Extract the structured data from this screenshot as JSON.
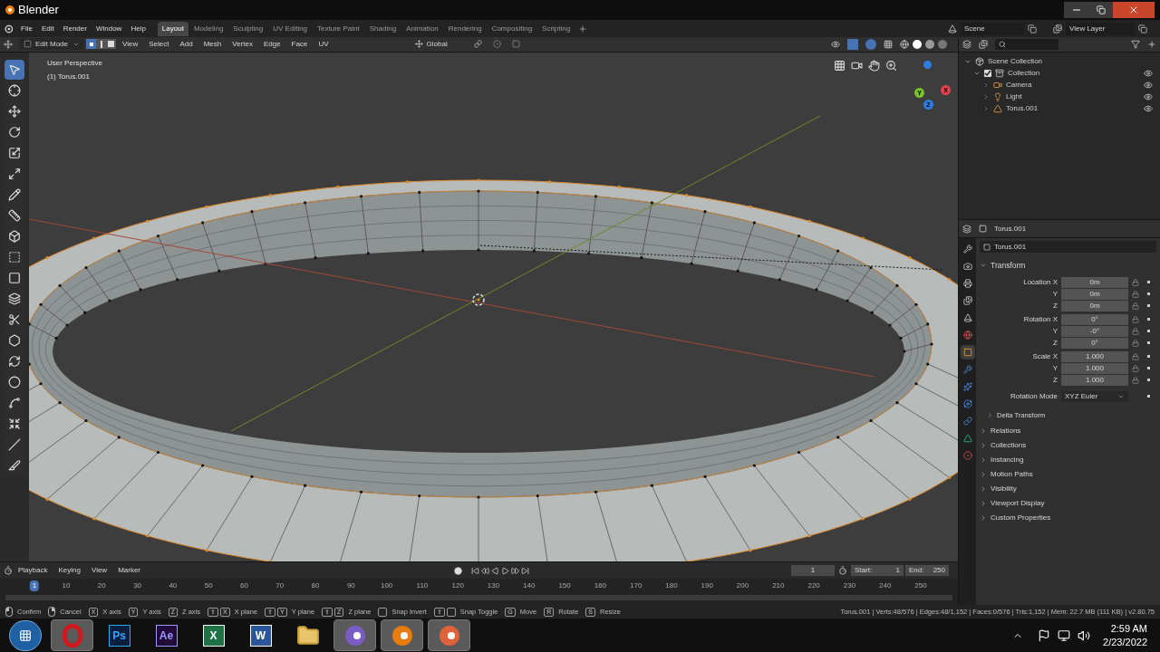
{
  "window": {
    "title": "Blender"
  },
  "menu": [
    "File",
    "Edit",
    "Render",
    "Window",
    "Help"
  ],
  "workspaces": [
    {
      "label": "Layout",
      "selected": true
    },
    {
      "label": "Modeling",
      "selected": false
    },
    {
      "label": "Sculpting",
      "selected": false
    },
    {
      "label": "UV Editing",
      "selected": false
    },
    {
      "label": "Texture Paint",
      "selected": false
    },
    {
      "label": "Shading",
      "selected": false
    },
    {
      "label": "Animation",
      "selected": false
    },
    {
      "label": "Rendering",
      "selected": false
    },
    {
      "label": "Compositing",
      "selected": false
    },
    {
      "label": "Scripting",
      "selected": false
    }
  ],
  "scene": {
    "scene": "Scene",
    "view_layer": "View Layer"
  },
  "viewport_header": {
    "mode": "Edit Mode",
    "select_modes": [
      {
        "kind": "vertex",
        "selected": true
      },
      {
        "kind": "edge",
        "selected": false
      },
      {
        "kind": "face",
        "selected": false
      }
    ],
    "menus": [
      "View",
      "Select",
      "Add",
      "Mesh",
      "Vertex",
      "Edge",
      "Face",
      "UV"
    ],
    "orientation": "Global"
  },
  "viewport": {
    "view_name": "User Perspective",
    "object_label": "(1) Torus.001",
    "gizmo": [
      {
        "label": "X",
        "color": "#e5414d"
      },
      {
        "label": "Y",
        "color": "#7bbf2a"
      },
      {
        "label": "Z",
        "color": "#2f7de0"
      }
    ]
  },
  "tools": [
    {
      "kind": "select",
      "selected": true
    },
    {
      "kind": "cursor",
      "selected": false
    },
    {
      "kind": "move",
      "selected": false
    },
    {
      "kind": "rotate",
      "selected": false
    },
    {
      "kind": "scale",
      "selected": false
    },
    {
      "kind": "transform",
      "selected": false
    },
    {
      "kind": "annotate",
      "selected": false
    },
    {
      "kind": "measure",
      "selected": false
    },
    {
      "kind": "extrude",
      "selected": false
    },
    {
      "kind": "inset",
      "selected": false
    },
    {
      "kind": "bevel",
      "selected": false
    },
    {
      "kind": "loop-cut",
      "selected": false
    },
    {
      "kind": "knife",
      "selected": false
    },
    {
      "kind": "poly-build",
      "selected": false
    },
    {
      "kind": "spin",
      "selected": false
    },
    {
      "kind": "smooth",
      "selected": false
    },
    {
      "kind": "edge-slide",
      "selected": false
    },
    {
      "kind": "shrink",
      "selected": false
    },
    {
      "kind": "shear",
      "selected": false
    },
    {
      "kind": "rip",
      "selected": false
    }
  ],
  "outliner": {
    "items": [
      {
        "label": "Scene Collection",
        "kind": "scene-collection",
        "children": [
          {
            "label": "Collection",
            "kind": "collection",
            "checked": true,
            "visible": true,
            "children": [
              {
                "label": "Camera",
                "kind": "camera",
                "visible": true
              },
              {
                "label": "Light",
                "kind": "light",
                "visible": true
              },
              {
                "label": "Torus.001",
                "kind": "mesh",
                "visible": true
              }
            ]
          }
        ]
      }
    ]
  },
  "properties": {
    "object_name": "Torus.001",
    "data_name": "Torus.001",
    "tabs": [
      {
        "kind": "tool",
        "selected": false
      },
      {
        "kind": "render",
        "selected": false
      },
      {
        "kind": "output",
        "selected": false
      },
      {
        "kind": "view-layer",
        "selected": false
      },
      {
        "kind": "scene",
        "selected": false
      },
      {
        "kind": "world",
        "selected": false
      },
      {
        "kind": "object",
        "selected": true
      },
      {
        "kind": "modifiers",
        "selected": false
      },
      {
        "kind": "particles",
        "selected": false
      },
      {
        "kind": "physics",
        "selected": false
      },
      {
        "kind": "constraints",
        "selected": false
      },
      {
        "kind": "data",
        "selected": false
      },
      {
        "kind": "material",
        "selected": false
      }
    ],
    "transform": {
      "title": "Transform",
      "expanded": true,
      "groups": [
        [
          {
            "label": "Location X",
            "value": "0m"
          },
          {
            "label": "Y",
            "value": "0m"
          },
          {
            "label": "Z",
            "value": "0m"
          }
        ],
        [
          {
            "label": "Rotation X",
            "value": "0°"
          },
          {
            "label": "Y",
            "value": "-0°"
          },
          {
            "label": "Z",
            "value": "0°"
          }
        ],
        [
          {
            "label": "Scale X",
            "value": "1.000"
          },
          {
            "label": "Y",
            "value": "1.000"
          },
          {
            "label": "Z",
            "value": "1.000"
          }
        ]
      ],
      "rotation_mode": {
        "label": "Rotation Mode",
        "value": "XYZ Euler"
      },
      "subpanels": [
        {
          "title": "Delta Transform",
          "expanded": false
        }
      ]
    },
    "panels": [
      {
        "title": "Relations",
        "expanded": false
      },
      {
        "title": "Collections",
        "expanded": false
      },
      {
        "title": "Instancing",
        "expanded": false
      },
      {
        "title": "Motion Paths",
        "expanded": false
      },
      {
        "title": "Visibility",
        "expanded": false
      },
      {
        "title": "Viewport Display",
        "expanded": false
      },
      {
        "title": "Custom Properties",
        "expanded": false
      }
    ]
  },
  "timeline": {
    "menus": [
      "Playback",
      "Keying",
      "View",
      "Marker"
    ],
    "current_frame": "1",
    "start_label": "Start:",
    "start": "1",
    "end_label": "End:",
    "end": "250",
    "ticks": [
      {
        "label": "1",
        "selected": true
      },
      {
        "label": "10",
        "selected": false
      },
      {
        "label": "20",
        "selected": false
      },
      {
        "label": "30",
        "selected": false
      },
      {
        "label": "40",
        "selected": false
      },
      {
        "label": "50",
        "selected": false
      },
      {
        "label": "60",
        "selected": false
      },
      {
        "label": "70",
        "selected": false
      },
      {
        "label": "80",
        "selected": false
      },
      {
        "label": "90",
        "selected": false
      },
      {
        "label": "100",
        "selected": false
      },
      {
        "label": "110",
        "selected": false
      },
      {
        "label": "120",
        "selected": false
      },
      {
        "label": "130",
        "selected": false
      },
      {
        "label": "140",
        "selected": false
      },
      {
        "label": "150",
        "selected": false
      },
      {
        "label": "160",
        "selected": false
      },
      {
        "label": "170",
        "selected": false
      },
      {
        "label": "180",
        "selected": false
      },
      {
        "label": "190",
        "selected": false
      },
      {
        "label": "200",
        "selected": false
      },
      {
        "label": "210",
        "selected": false
      },
      {
        "label": "220",
        "selected": false
      },
      {
        "label": "230",
        "selected": false
      },
      {
        "label": "240",
        "selected": false
      },
      {
        "label": "250",
        "selected": false
      }
    ]
  },
  "status_bar": {
    "hints": [
      {
        "kind": "mouse-left",
        "label": "Confirm"
      },
      {
        "kind": "mouse-right",
        "label": "Cancel"
      },
      {
        "kind": "key",
        "keys": [
          "X"
        ],
        "label": "X axis"
      },
      {
        "kind": "key",
        "keys": [
          "Y"
        ],
        "label": "Y axis"
      },
      {
        "kind": "key",
        "keys": [
          "Z"
        ],
        "label": "Z axis"
      },
      {
        "kind": "key",
        "keys": [
          "⇧",
          "X"
        ],
        "label": "X plane"
      },
      {
        "kind": "key",
        "keys": [
          "⇧",
          "Y"
        ],
        "label": "Y plane"
      },
      {
        "kind": "key",
        "keys": [
          "⇧",
          "Z"
        ],
        "label": "Z plane"
      },
      {
        "kind": "blank-key",
        "label": "Snap Invert"
      },
      {
        "kind": "blank-key",
        "keys": [
          "⇧"
        ],
        "label": "Snap Toggle"
      },
      {
        "kind": "key",
        "keys": [
          "G"
        ],
        "label": "Move"
      },
      {
        "kind": "key",
        "keys": [
          "R"
        ],
        "label": "Rotate"
      },
      {
        "kind": "key",
        "keys": [
          "S"
        ],
        "label": "Resize"
      }
    ],
    "stats": "Torus.001 | Verts:48/576 | Edges:48/1,152 | Faces:0/576 | Tris:1,152 | Mem: 22.7 MB (111 KB) | v2.80.75"
  },
  "taskbar": {
    "apps": [
      {
        "kind": "opera",
        "running": true
      },
      {
        "kind": "photoshop",
        "glyph": "Ps",
        "running": false
      },
      {
        "kind": "after-effects",
        "glyph": "Ae",
        "running": false
      },
      {
        "kind": "excel",
        "glyph": "X",
        "running": false
      },
      {
        "kind": "word",
        "glyph": "W",
        "running": false
      },
      {
        "kind": "explorer",
        "running": false
      },
      {
        "kind": "torrent",
        "running": true
      },
      {
        "kind": "blender",
        "running": true
      },
      {
        "kind": "presentation",
        "running": true
      }
    ],
    "clock": {
      "time": "2:59 AM",
      "date": "2/23/2022"
    }
  }
}
